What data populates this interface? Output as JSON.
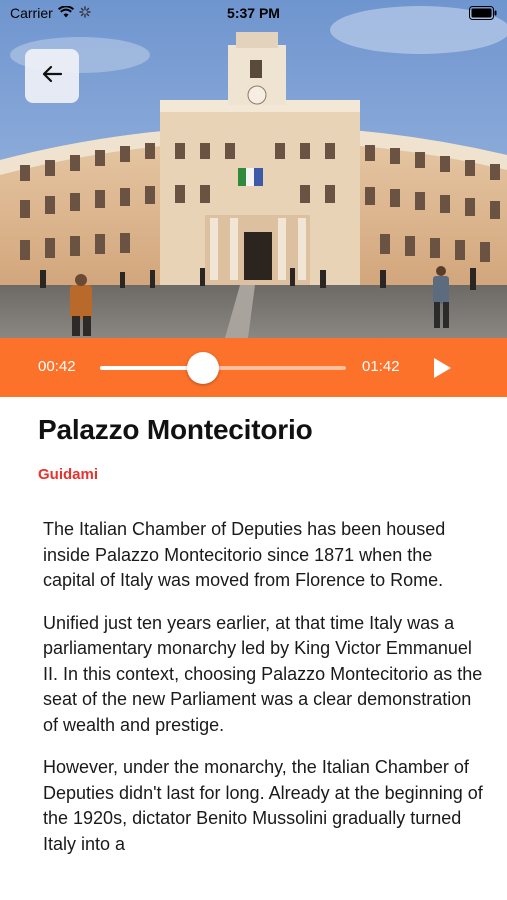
{
  "status_bar": {
    "carrier": "Carrier",
    "time": "5:37 PM"
  },
  "player": {
    "current_time": "00:42",
    "total_time": "01:42",
    "progress": 0.42
  },
  "article": {
    "title": "Palazzo Montecitorio",
    "author": "Guidami",
    "paragraphs": [
      "The Italian Chamber of Deputies has been housed inside Palazzo Montecitorio since 1871 when the capital of Italy was moved from Florence to Rome.",
      "Unified just ten years earlier, at that time Italy was a parliamentary monarchy led by King Victor Emmanuel II. In this context, choosing Palazzo Montecitorio as the seat of the new Parliament was a clear demonstration of wealth and prestige.",
      "However, under the monarchy, the Italian Chamber of Deputies didn't last for long. Already at the beginning of the 1920s, dictator Benito Mussolini gradually turned Italy into a"
    ]
  },
  "colors": {
    "accent": "#fd722a",
    "author": "#e8322b"
  },
  "icons": {
    "back": "arrow-left-icon",
    "play": "play-icon",
    "wifi": "wifi-icon",
    "battery": "battery-icon"
  }
}
